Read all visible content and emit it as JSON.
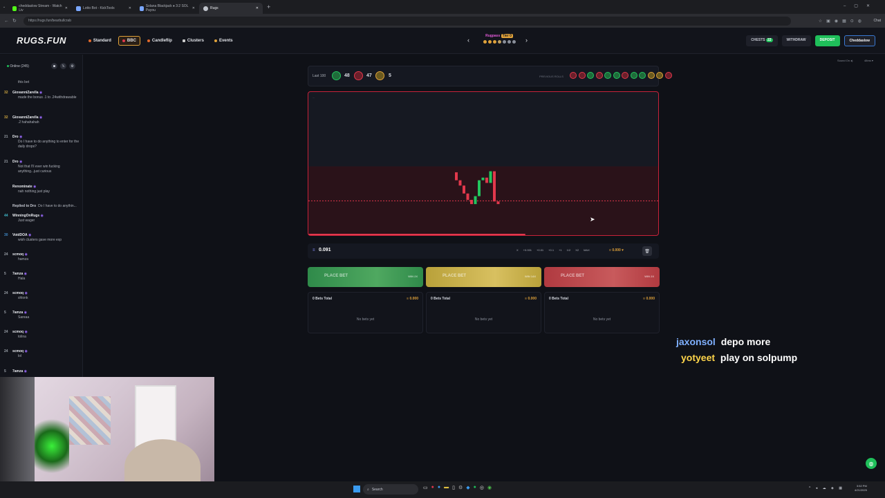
{
  "browser": {
    "tabs": [
      {
        "label": "cheddaslow Stream - Watch Liv",
        "color": "#53fc18"
      },
      {
        "label": "Lotto Bot - KickTools",
        "color": "#7aa7ff"
      },
      {
        "label": "Solana Blackjack ♦ 3:2 SOL Payou",
        "color": "#7aa7ff"
      },
      {
        "label": "Rugs",
        "color": "#c0c4cc"
      }
    ],
    "url": "https://rugs.fun/bearbullcrab"
  },
  "header": {
    "logo": "RUGS.FUN",
    "nav": [
      {
        "label": "Standard",
        "color": "#e26a2c",
        "active": false
      },
      {
        "label": "BBC",
        "color": "#e2384c",
        "active": true
      },
      {
        "label": "Candleflip",
        "color": "#e26a2c",
        "active": false
      },
      {
        "label": "Clusters",
        "color": "#cccccc",
        "active": false
      },
      {
        "label": "Events",
        "color": "#e0a23a",
        "active": false
      }
    ],
    "center_label": "Rugpass",
    "center_tier": "Tier 0",
    "chests_label": "CHESTS",
    "chests_count": "22",
    "withdraw_label": "WITHDRAW",
    "deposit_label": "DEPOSIT",
    "user_label": "Cheddaslow",
    "sound_label": "Sound On",
    "latency_label": "48ms"
  },
  "sidebar": {
    "online_label": "Online (245)",
    "messages": [
      {
        "level": "",
        "user": "",
        "text": "this bet",
        "lvl_color": "#cfa640"
      },
      {
        "level": "32",
        "user": "GiovanniZarella",
        "text": "made the bonus .1 to .24withdrawable",
        "lvl_color": "#cfa640"
      },
      {
        "level": "32",
        "user": "GiovanniZarella",
        "text": ".2 hahahahah",
        "lvl_color": "#cfa640"
      },
      {
        "level": "21",
        "user": "Dro",
        "text": "Do I have to do anything to enter for the daily drops?",
        "lvl_color": "#9aa0a8"
      },
      {
        "level": "21",
        "user": "Dro",
        "text": "Not that I'll ever win fucking anything...just curious",
        "lvl_color": "#9aa0a8"
      },
      {
        "level": "",
        "user": "Renominate",
        "text": "nah nothing just play",
        "lvl_color": "#9aa0a8"
      },
      {
        "level": "",
        "user": "Replied to Dro",
        "text": "Do I have to do anythin...",
        "lvl_color": "#9aa0a8"
      },
      {
        "level": "44",
        "user": "WinningOnRugs",
        "text": "Just wager",
        "lvl_color": "#3fb8c9"
      },
      {
        "level": "30",
        "user": "VoidDOA",
        "text": "wish clusters gave more exp",
        "lvl_color": "#3f8ac9"
      },
      {
        "level": "24",
        "user": "scmoq",
        "text": "hamza",
        "lvl_color": "#9aa0a8"
      },
      {
        "level": "5",
        "user": "7amza",
        "text": "Hala",
        "lvl_color": "#9aa0a8"
      },
      {
        "level": "24",
        "user": "scmoq",
        "text": "shlonk",
        "lvl_color": "#9aa0a8"
      },
      {
        "level": "5",
        "user": "7amza",
        "text": "Sareaa",
        "lvl_color": "#9aa0a8"
      },
      {
        "level": "24",
        "user": "scmoq",
        "text": "tolina",
        "lvl_color": "#9aa0a8"
      },
      {
        "level": "24",
        "user": "scmoq",
        "text": "lol",
        "lvl_color": "#9aa0a8"
      },
      {
        "level": "5",
        "user": "7amza",
        "text": "",
        "lvl_color": "#9aa0a8"
      }
    ]
  },
  "history": {
    "last_label": "Last 100",
    "bull_count": "48",
    "bear_count": "47",
    "crab_count": "5",
    "previous_label": "PREVIOUS ROLLS",
    "previous": [
      "bear",
      "bear",
      "bull",
      "bear",
      "bull",
      "bull",
      "bear",
      "bull",
      "bull",
      "crab",
      "crab",
      "bear"
    ]
  },
  "chart": {
    "corner_label": "...",
    "candles": [
      {
        "o": 0.7,
        "c": 0.55,
        "color": "#e2384c"
      },
      {
        "o": 0.55,
        "c": 0.45,
        "color": "#e2384c"
      },
      {
        "o": 0.45,
        "c": 0.3,
        "color": "#e2384c"
      },
      {
        "o": 0.3,
        "c": 0.18,
        "color": "#e2384c"
      },
      {
        "o": 0.18,
        "c": 0.1,
        "color": "#e2384c"
      },
      {
        "o": 0.1,
        "c": 0.25,
        "color": "#22c55e"
      },
      {
        "o": 0.25,
        "c": 0.55,
        "color": "#22c55e"
      },
      {
        "o": 0.55,
        "c": 0.6,
        "color": "#22c55e"
      },
      {
        "o": 0.6,
        "c": 0.5,
        "color": "#e2384c"
      },
      {
        "o": 0.5,
        "c": 0.72,
        "color": "#22c55e"
      },
      {
        "o": 0.72,
        "c": 0.15,
        "color": "#e2384c"
      },
      {
        "o": 0.15,
        "c": 0.1,
        "color": "#e2384c"
      }
    ]
  },
  "bet": {
    "amount": "0.091",
    "chips": [
      "X",
      "+0.001",
      "+0.01",
      "+0.1",
      "+1",
      "1/2",
      "X2",
      "MAX"
    ],
    "balance": "0.000"
  },
  "place_buttons": [
    {
      "label": "PLACE BET",
      "win": "WIN 2X",
      "color": "#2f8a4a"
    },
    {
      "label": "PLACE BET",
      "win": "WIN 14X",
      "color": "#b9a13a"
    },
    {
      "label": "PLACE BET",
      "win": "WIN 2X",
      "color": "#b03a40"
    }
  ],
  "bet_panels": [
    {
      "title": "0 Bets Total",
      "amount": "0.000",
      "empty": "No bets yet"
    },
    {
      "title": "0 Bets Total",
      "amount": "0.000",
      "empty": "No bets yet"
    },
    {
      "title": "0 Bets Total",
      "amount": "0.000",
      "empty": "No bets yet"
    }
  ],
  "stream_chat": [
    {
      "user": "jaxonsol",
      "text": "depo more",
      "color": "#7fb0ff"
    },
    {
      "user": "yotyeet",
      "text": "play on solpump",
      "color": "#ffd54a"
    }
  ],
  "taskbar": {
    "search_label": "Search",
    "time": "3:52 PM",
    "date": "4/21/2025"
  }
}
